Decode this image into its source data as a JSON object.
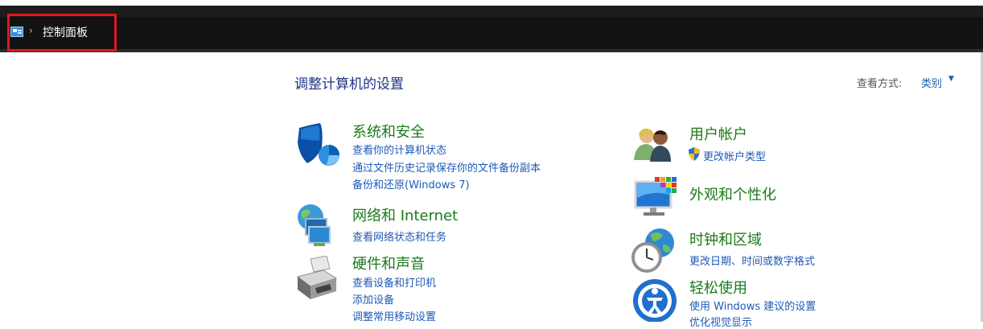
{
  "window": {
    "breadcrumb": "控制面板"
  },
  "main": {
    "title": "调整计算机的设置",
    "view_by_label": "查看方式:",
    "view_by_value": "类别"
  },
  "categories_left": [
    {
      "title": "系统和安全",
      "links": [
        "查看你的计算机状态",
        "通过文件历史记录保存你的文件备份副本",
        "备份和还原(Windows 7)"
      ]
    },
    {
      "title": "网络和 Internet",
      "links": [
        "查看网络状态和任务"
      ]
    },
    {
      "title": "硬件和声音",
      "links": [
        "查看设备和打印机",
        "添加设备",
        "调整常用移动设置"
      ]
    }
  ],
  "categories_right": [
    {
      "title": "用户帐户",
      "links": [
        "更改帐户类型"
      ]
    },
    {
      "title": "外观和个性化",
      "links": []
    },
    {
      "title": "时钟和区域",
      "links": [
        "更改日期、时间或数字格式"
      ]
    },
    {
      "title": "轻松使用",
      "links": [
        "使用 Windows 建议的设置",
        "优化视觉显示"
      ]
    }
  ],
  "colors": {
    "category_title": "#1a7a1a",
    "link": "#1e5ab8",
    "page_title": "#1e3287",
    "highlight_box": "#e0161f"
  },
  "icons": {
    "breadcrumb": "control-panel-icon",
    "system_security": "shield-icon",
    "network": "globe-network-icon",
    "hardware": "printer-icon",
    "users": "users-icon",
    "appearance": "monitor-icon",
    "clock": "clock-globe-icon",
    "ease": "ease-of-access-icon",
    "uac": "uac-shield-icon"
  }
}
